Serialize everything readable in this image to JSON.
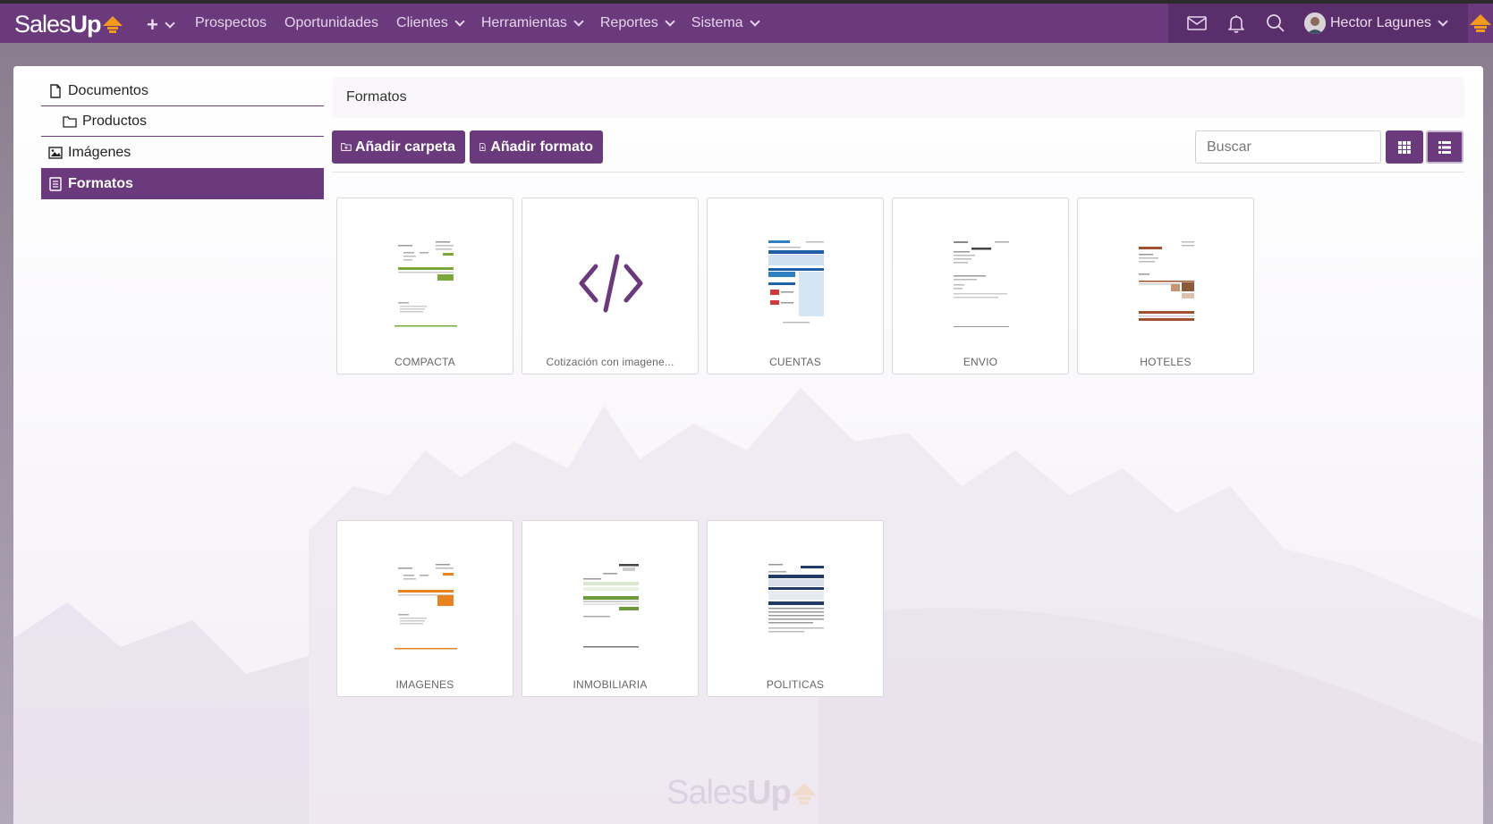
{
  "brand": {
    "name_part1": "Sales",
    "name_part2": "Up",
    "accent": "#f39a1d",
    "primary": "#6b3a7d"
  },
  "nav": {
    "add_symbol": "+",
    "items": [
      {
        "label": "Prospectos",
        "dropdown": false
      },
      {
        "label": "Oportunidades",
        "dropdown": false
      },
      {
        "label": "Clientes",
        "dropdown": true
      },
      {
        "label": "Herramientas",
        "dropdown": true
      },
      {
        "label": "Reportes",
        "dropdown": true
      },
      {
        "label": "Sistema",
        "dropdown": true
      }
    ],
    "icons": [
      "envelope-icon",
      "bell-icon",
      "search-icon"
    ],
    "user_name": "Hector Lagunes"
  },
  "sidebar": {
    "items": [
      {
        "label": "Documentos",
        "icon": "file-icon"
      },
      {
        "label": "Productos",
        "icon": "folder-icon"
      },
      {
        "label": "Imágenes",
        "icon": "image-icon"
      },
      {
        "label": "Formatos",
        "icon": "book-icon",
        "active": true
      }
    ]
  },
  "main": {
    "breadcrumb": "Formatos",
    "add_folder_label": "Añadir carpeta",
    "add_format_label": "Añadir formato",
    "search_placeholder": "Buscar",
    "view_modes": [
      "grid-view-icon",
      "list-view-icon"
    ]
  },
  "formats": [
    {
      "label": "COMPACTA",
      "thumb": "green"
    },
    {
      "label": "Cotización con imagene...",
      "thumb": "code"
    },
    {
      "label": "CUENTAS",
      "thumb": "blue"
    },
    {
      "label": "ENVIO",
      "thumb": "plain"
    },
    {
      "label": "HOTELES",
      "thumb": "brown"
    },
    {
      "label": "IMAGENES",
      "thumb": "orange"
    },
    {
      "label": "INMOBILIARIA",
      "thumb": "green-table"
    },
    {
      "label": "POLITICAS",
      "thumb": "navy"
    }
  ],
  "footer": {
    "logo_part1": "Sales",
    "logo_part2": "Up"
  }
}
